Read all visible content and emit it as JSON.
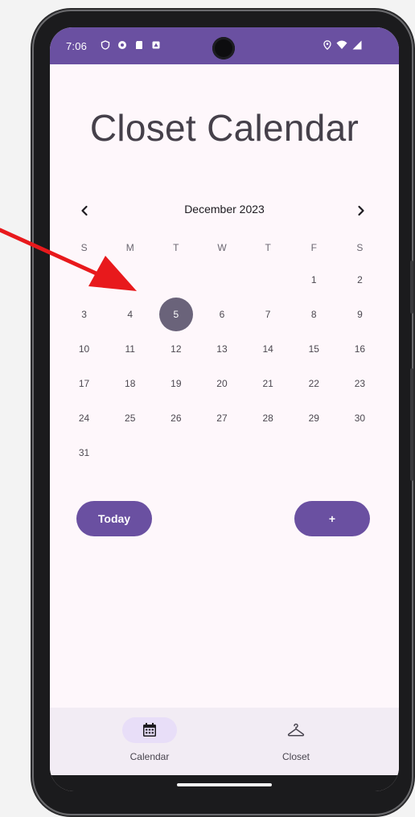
{
  "status_bar": {
    "time": "7:06"
  },
  "app": {
    "title": "Closet Calendar"
  },
  "calendar": {
    "month_label": "December 2023",
    "prev_icon": "chevron-left-icon",
    "next_icon": "chevron-right-icon",
    "weekdays": [
      "S",
      "M",
      "T",
      "W",
      "T",
      "F",
      "S"
    ],
    "weeks": [
      [
        "",
        "",
        "",
        "",
        "",
        "1",
        "2"
      ],
      [
        "3",
        "4",
        "5",
        "6",
        "7",
        "8",
        "9"
      ],
      [
        "10",
        "11",
        "12",
        "13",
        "14",
        "15",
        "16"
      ],
      [
        "17",
        "18",
        "19",
        "20",
        "21",
        "22",
        "23"
      ],
      [
        "24",
        "25",
        "26",
        "27",
        "28",
        "29",
        "30"
      ],
      [
        "31",
        "",
        "",
        "",
        "",
        "",
        ""
      ]
    ],
    "selected_day": "5"
  },
  "actions": {
    "today_label": "Today",
    "add_label": "+"
  },
  "bottom_nav": {
    "items": [
      {
        "label": "Calendar",
        "icon": "calendar-icon",
        "selected": true
      },
      {
        "label": "Closet",
        "icon": "hanger-icon",
        "selected": false
      }
    ]
  },
  "colors": {
    "primary": "#6a50a1",
    "selected_day": "#6a637a",
    "background": "#fef7fb",
    "nav_background": "#f2ecf4",
    "nav_indicator": "#e8def8",
    "annotation_arrow": "#e8191c"
  }
}
